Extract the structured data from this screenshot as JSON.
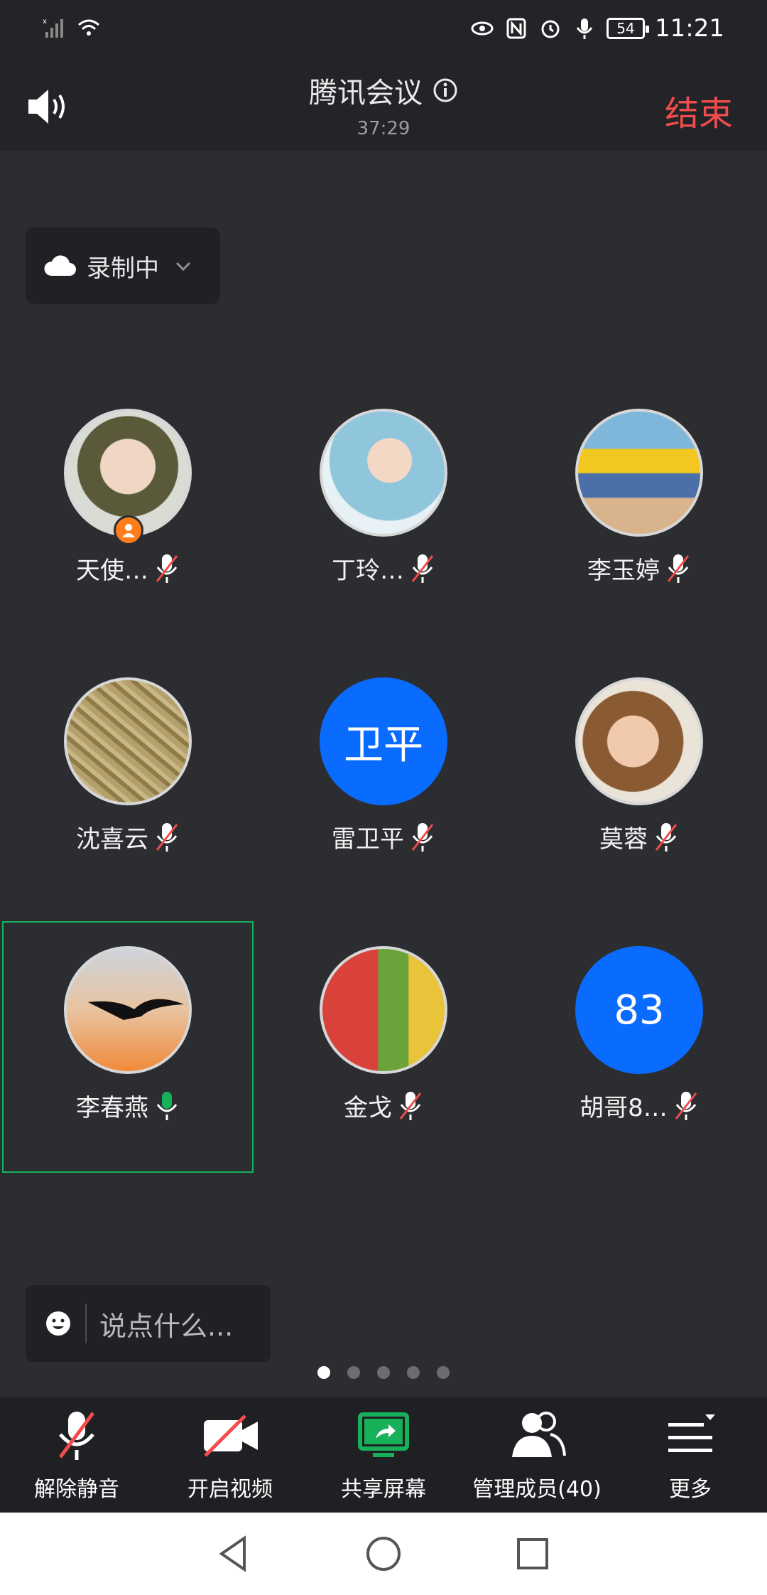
{
  "status_bar": {
    "battery": "54",
    "time": "11:21"
  },
  "header": {
    "title": "腾讯会议",
    "duration": "37:29",
    "end_label": "结束"
  },
  "recording": {
    "label": "录制中"
  },
  "participants": [
    {
      "name": "天使…",
      "mic": "muted",
      "host": true,
      "avatar": "photo"
    },
    {
      "name": "丁玲…",
      "mic": "muted",
      "avatar": "photo"
    },
    {
      "name": "李玉婷",
      "mic": "muted",
      "avatar": "photo"
    },
    {
      "name": "沈喜云",
      "mic": "muted",
      "avatar": "photo"
    },
    {
      "name": "雷卫平",
      "mic": "muted",
      "avatar": "initials",
      "initials": "卫平"
    },
    {
      "name": "莫蓉",
      "mic": "muted",
      "avatar": "photo"
    },
    {
      "name": "李春燕",
      "mic": "speaking",
      "avatar": "photo",
      "active": true
    },
    {
      "name": "金戈",
      "mic": "muted",
      "avatar": "photo"
    },
    {
      "name": "胡哥8…",
      "mic": "muted",
      "avatar": "initials",
      "initials": "83"
    }
  ],
  "chat": {
    "placeholder": "说点什么..."
  },
  "pagination": {
    "total": 5,
    "current": 1
  },
  "toolbar": {
    "unmute": "解除静音",
    "video": "开启视频",
    "share": "共享屏幕",
    "members": "管理成员(40)",
    "more": "更多"
  },
  "colors": {
    "accent_red": "#f24c4c",
    "avatar_blue": "#0a6cff",
    "speaking_green": "#17b15a",
    "host_orange": "#ff7d1a"
  }
}
